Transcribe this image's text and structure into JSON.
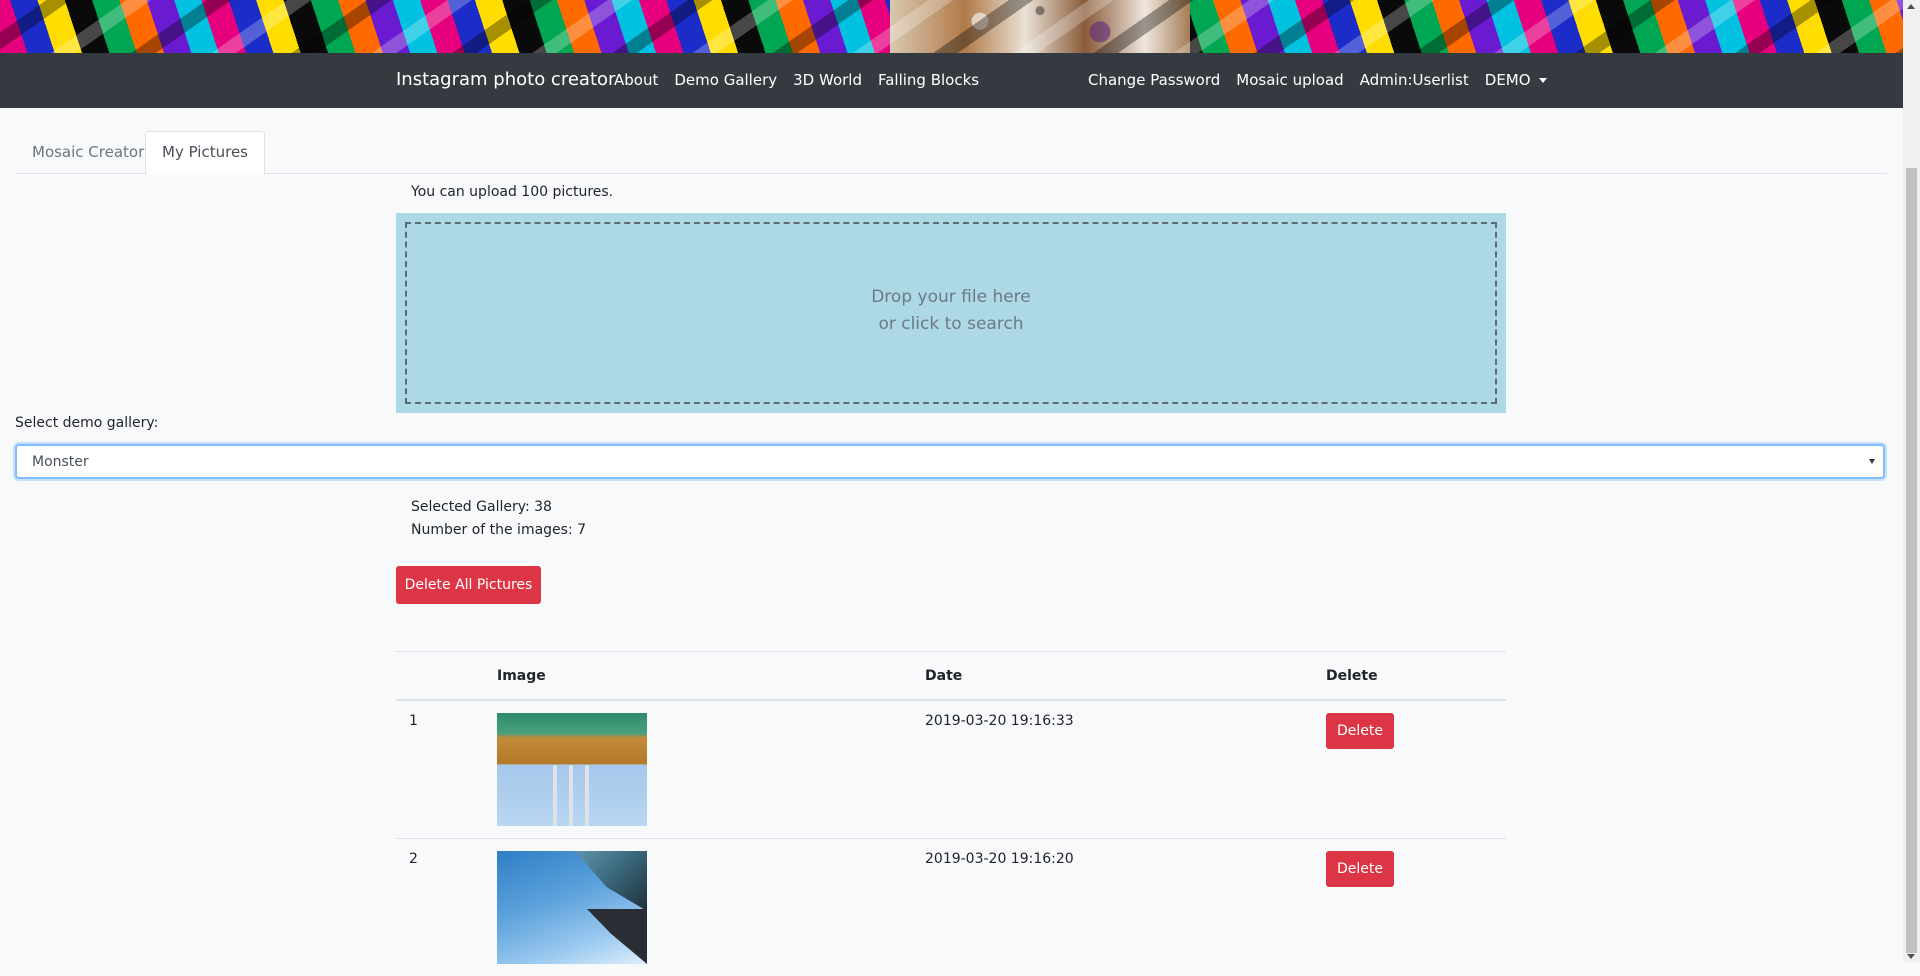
{
  "navbar": {
    "brand": "Instagram photo creator",
    "left_links": [
      "About",
      "Demo Gallery",
      "3D World",
      "Falling Blocks"
    ],
    "right_links": [
      "Change Password",
      "Mosaic upload",
      "Admin:Userlist"
    ],
    "user_menu": "DEMO"
  },
  "tabs": [
    {
      "label": "Mosaic Creator",
      "active": false
    },
    {
      "label": "My Pictures",
      "active": true
    }
  ],
  "upload": {
    "limit_text": "You can upload 100 pictures.",
    "drop_line1": "Drop your file here",
    "drop_line2": "or click to search"
  },
  "gallery": {
    "select_label": "Select demo gallery:",
    "selected_value": "Monster",
    "selected_gallery_text": "Selected Gallery: 38",
    "image_count_text": "Number of the images: 7",
    "delete_all_label": "Delete All Pictures"
  },
  "table": {
    "headers": [
      "",
      "Image",
      "Date",
      "Delete"
    ],
    "rows": [
      {
        "index": "1",
        "date": "2019-03-20 19:16:33",
        "delete_label": "Delete"
      },
      {
        "index": "2",
        "date": "2019-03-20 19:16:20",
        "delete_label": "Delete"
      }
    ]
  },
  "colors": {
    "navbar_bg": "#343a40",
    "dropzone_bg": "#add8e6",
    "danger": "#dc3545"
  }
}
